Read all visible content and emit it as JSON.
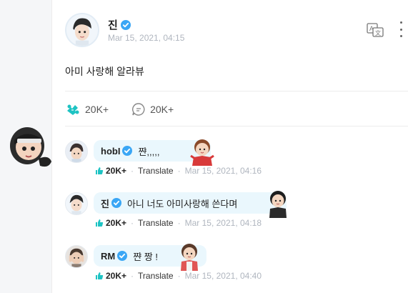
{
  "post": {
    "author": "진",
    "date": "Mar 15, 2021, 04:15",
    "body": "아미 사랑해 알라뷰",
    "likes": "20K+",
    "comments": "20K+"
  },
  "comments": [
    {
      "name": "hobI",
      "text": "쨘,,,,,",
      "likes": "20K+",
      "translate": "Translate",
      "time": "Mar 15, 2021, 04:16"
    },
    {
      "name": "진",
      "text": "아니 너도 아미사랑해 쓴다며",
      "likes": "20K+",
      "translate": "Translate",
      "time": "Mar 15, 2021, 04:18"
    },
    {
      "name": "RM",
      "text": "쨘 짱 !",
      "likes": "20K+",
      "translate": "Translate",
      "time": "Mar 15, 2021, 04:40"
    }
  ],
  "colors": {
    "accent": "#1ec3c3",
    "verified": "#3aa6f5",
    "bubble": "#eaf7fd",
    "meta": "#b0b6bf"
  },
  "icons": [
    "verified-icon",
    "translate-icon",
    "more-icon",
    "like-icon",
    "comment-icon",
    "thumbs-up-icon"
  ]
}
